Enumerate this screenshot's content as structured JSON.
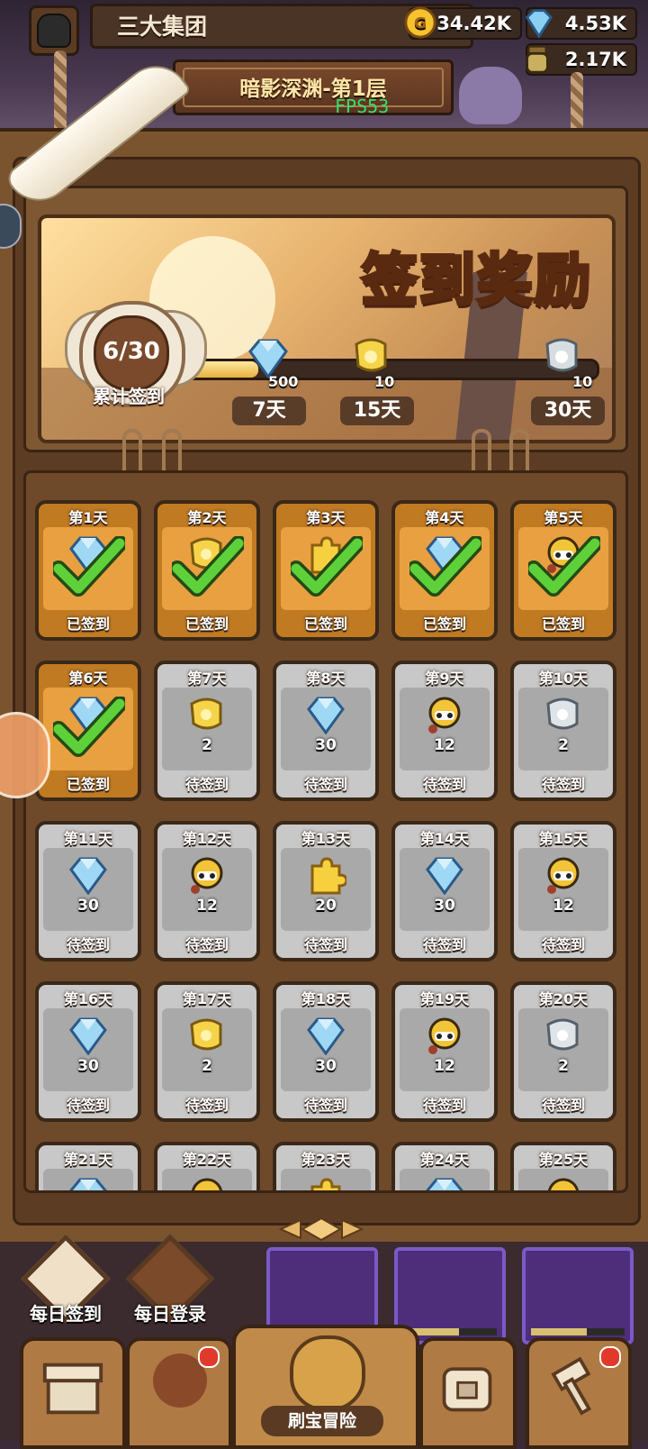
{
  "header": {
    "player_name": "三大集团",
    "resources": {
      "gold": "34.42K",
      "diamond": "4.53K",
      "potion": "2.17K"
    },
    "stage_title": "暗影深渊-第1层",
    "fps": "FPS53"
  },
  "signin": {
    "title": "签到奖励",
    "progress_count": "6/30",
    "progress_label": "累计签到",
    "progress_fraction": 0.2,
    "milestones": [
      {
        "amount": "500",
        "day": "7天",
        "icon": "diamond-icon"
      },
      {
        "amount": "10",
        "day": "15天",
        "icon": "gold-scroll-icon"
      },
      {
        "amount": "10",
        "day": "30天",
        "icon": "silver-scroll-icon"
      }
    ],
    "days": [
      {
        "day": "第1天",
        "status": "已签到",
        "signed": true,
        "icon": "diamond-icon",
        "amount": ""
      },
      {
        "day": "第2天",
        "status": "已签到",
        "signed": true,
        "icon": "gold-scroll-icon",
        "amount": ""
      },
      {
        "day": "第3天",
        "status": "已签到",
        "signed": true,
        "icon": "puzzle-icon",
        "amount": ""
      },
      {
        "day": "第4天",
        "status": "已签到",
        "signed": true,
        "icon": "diamond-icon",
        "amount": ""
      },
      {
        "day": "第5天",
        "status": "已签到",
        "signed": true,
        "icon": "hero-icon",
        "amount": ""
      },
      {
        "day": "第6天",
        "status": "已签到",
        "signed": true,
        "icon": "diamond-icon",
        "amount": ""
      },
      {
        "day": "第7天",
        "status": "待签到",
        "signed": false,
        "icon": "gold-scroll-icon",
        "amount": "2"
      },
      {
        "day": "第8天",
        "status": "待签到",
        "signed": false,
        "icon": "diamond-icon",
        "amount": "30"
      },
      {
        "day": "第9天",
        "status": "待签到",
        "signed": false,
        "icon": "hero-icon",
        "amount": "12"
      },
      {
        "day": "第10天",
        "status": "待签到",
        "signed": false,
        "icon": "silver-scroll-icon",
        "amount": "2"
      },
      {
        "day": "第11天",
        "status": "待签到",
        "signed": false,
        "icon": "diamond-icon",
        "amount": "30"
      },
      {
        "day": "第12天",
        "status": "待签到",
        "signed": false,
        "icon": "hero-icon",
        "amount": "12"
      },
      {
        "day": "第13天",
        "status": "待签到",
        "signed": false,
        "icon": "puzzle-icon",
        "amount": "20"
      },
      {
        "day": "第14天",
        "status": "待签到",
        "signed": false,
        "icon": "diamond-icon",
        "amount": "30"
      },
      {
        "day": "第15天",
        "status": "待签到",
        "signed": false,
        "icon": "hero-icon",
        "amount": "12"
      },
      {
        "day": "第16天",
        "status": "待签到",
        "signed": false,
        "icon": "diamond-icon",
        "amount": "30"
      },
      {
        "day": "第17天",
        "status": "待签到",
        "signed": false,
        "icon": "gold-scroll-icon",
        "amount": "2"
      },
      {
        "day": "第18天",
        "status": "待签到",
        "signed": false,
        "icon": "diamond-icon",
        "amount": "30"
      },
      {
        "day": "第19天",
        "status": "待签到",
        "signed": false,
        "icon": "hero-icon",
        "amount": "12"
      },
      {
        "day": "第20天",
        "status": "待签到",
        "signed": false,
        "icon": "silver-scroll-icon",
        "amount": "2"
      },
      {
        "day": "第21天",
        "status": "",
        "signed": false,
        "icon": "diamond-icon",
        "amount": ""
      },
      {
        "day": "第22天",
        "status": "",
        "signed": false,
        "icon": "hero-icon",
        "amount": ""
      },
      {
        "day": "第23天",
        "status": "",
        "signed": false,
        "icon": "puzzle-icon",
        "amount": ""
      },
      {
        "day": "第24天",
        "status": "",
        "signed": false,
        "icon": "diamond-icon",
        "amount": ""
      },
      {
        "day": "第25天",
        "status": "",
        "signed": false,
        "icon": "hero-icon",
        "amount": ""
      }
    ]
  },
  "bottom": {
    "daily_signin_label": "每日签到",
    "daily_login_label": "每日登录",
    "adventure_label": "刷宝冒险"
  },
  "colors": {
    "signed_cell": "#c07a22",
    "pending_cell": "#c8c8c8",
    "check_green": "#5ed13a",
    "panel_wood": "#7a532f"
  }
}
